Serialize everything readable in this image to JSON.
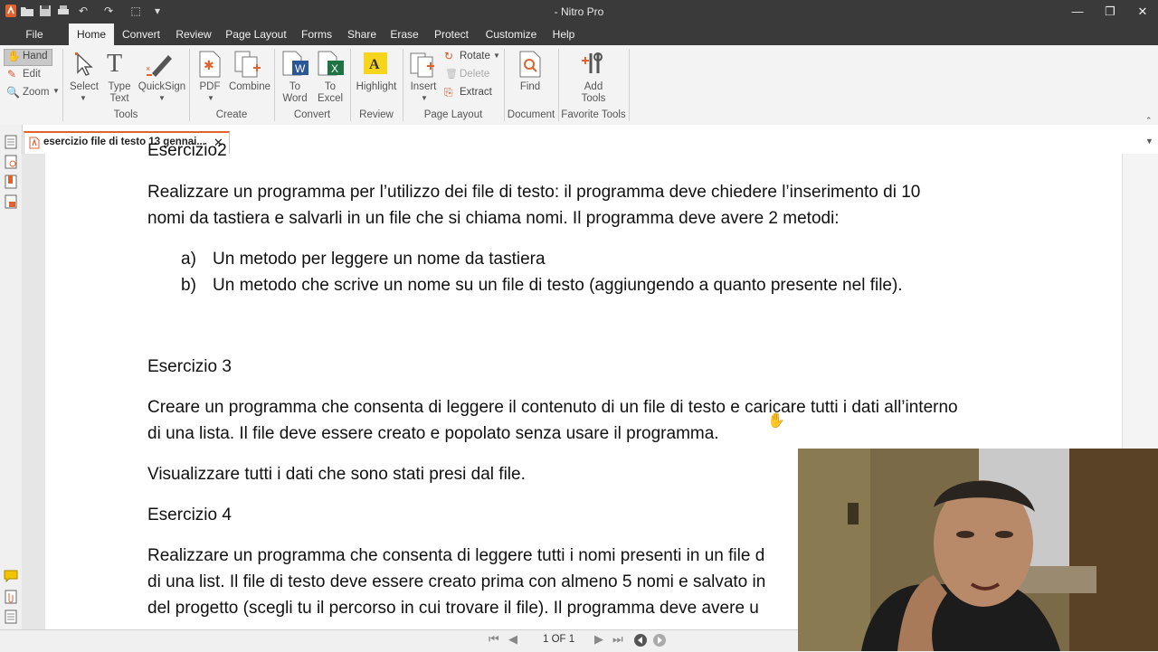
{
  "window": {
    "title": "- Nitro Pro"
  },
  "menu": {
    "items": [
      "File",
      "Home",
      "Convert",
      "Review",
      "Page Layout",
      "Forms",
      "Share",
      "Erase",
      "Protect",
      "Customize",
      "Help"
    ]
  },
  "ribbon": {
    "nav": {
      "hand": "Hand",
      "edit": "Edit",
      "zoom": "Zoom"
    },
    "tools": {
      "select": "Select",
      "type_text_1": "Type",
      "type_text_2": "Text",
      "quicksign": "QuickSign",
      "group": "Tools"
    },
    "create": {
      "pdf": "PDF",
      "combine": "Combine",
      "group": "Create"
    },
    "convert": {
      "to_word_1": "To",
      "to_word_2": "Word",
      "to_excel_1": "To",
      "to_excel_2": "Excel",
      "group": "Convert"
    },
    "review": {
      "highlight": "Highlight",
      "group": "Review"
    },
    "page_layout": {
      "insert": "Insert",
      "rotate": "Rotate",
      "delete": "Delete",
      "extract": "Extract",
      "group": "Page Layout"
    },
    "document": {
      "find": "Find",
      "group": "Document"
    },
    "favorite": {
      "add_1": "Add",
      "add_2": "Tools",
      "group": "Favorite Tools"
    }
  },
  "tab": {
    "label": "esercizio file di testo 13 gennai..."
  },
  "document": {
    "partial_heading": "Esercizio2",
    "ex2_line1": "Realizzare un programma per l’utilizzo dei file di testo: il programma deve chiedere l’inserimento di 10",
    "ex2_line2": "nomi da tastiera e salvarli in un file che si chiama nomi. Il programma deve avere 2 metodi:",
    "item_a_marker": "a)",
    "item_a": "Un metodo per leggere un nome da tastiera",
    "item_b_marker": "b)",
    "item_b": "Un metodo che scrive un nome su un file di testo (aggiungendo a quanto presente nel file).",
    "ex3_heading": "Esercizio 3",
    "ex3_line1": "Creare un programma che consenta di leggere il contenuto di un file di testo e caricare tutti i dati all’interno",
    "ex3_line2": "di una lista. Il file deve essere creato e popolato senza usare il programma.",
    "ex3_line3": "Visualizzare tutti i dati che sono stati presi dal file.",
    "ex4_heading": "Esercizio 4",
    "ex4_line1": "Realizzare un programma che consenta di leggere tutti i nomi presenti in un file d",
    "ex4_line2": "di una list. Il file di testo deve essere creato prima con almeno 5 nomi e salvato in",
    "ex4_line3": "del progetto (scegli tu il percorso in cui trovare il file). Il programma deve avere u"
  },
  "statusbar": {
    "page_indicator": "1 OF 1"
  },
  "colors": {
    "accent": "#e0622f",
    "chrome_dark": "#3a3a3a",
    "ribbon_bg": "#f3f3f3"
  }
}
